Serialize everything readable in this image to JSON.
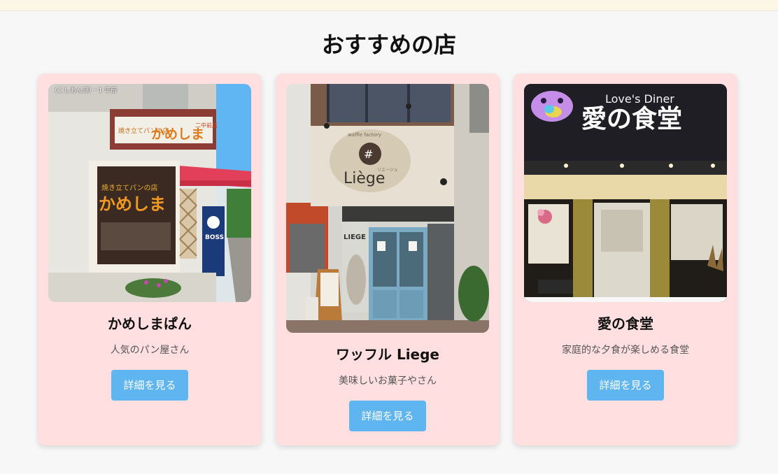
{
  "page": {
    "heading": "おすすめの店"
  },
  "shops": [
    {
      "name": "かめしまぱん",
      "description": "人気のパン屋さん",
      "button_label": "詳細を見る",
      "photo_overlay": "（こしあん派）・1 年前",
      "sign_small": "焼き立てパンの店",
      "sign_big": "かめしま",
      "sign_branch": "二中前店",
      "window_text": "かめしま",
      "window_small": "焼き立てパンの店",
      "vending_text": "BOSS"
    },
    {
      "name": "ワッフル Liege",
      "description": "美味しいお菓子やさん",
      "button_label": "詳細を見る",
      "sign_top": "waffle factory",
      "sign_name": "Liège",
      "sign_kana": "リエージュ",
      "glass_text": "LIEGE"
    },
    {
      "name": "愛の食堂",
      "description": "家庭的な夕食が楽しめる食堂",
      "button_label": "詳細を見る",
      "sign_en": "Love's Diner",
      "sign_jp": "愛の食堂"
    }
  ]
}
